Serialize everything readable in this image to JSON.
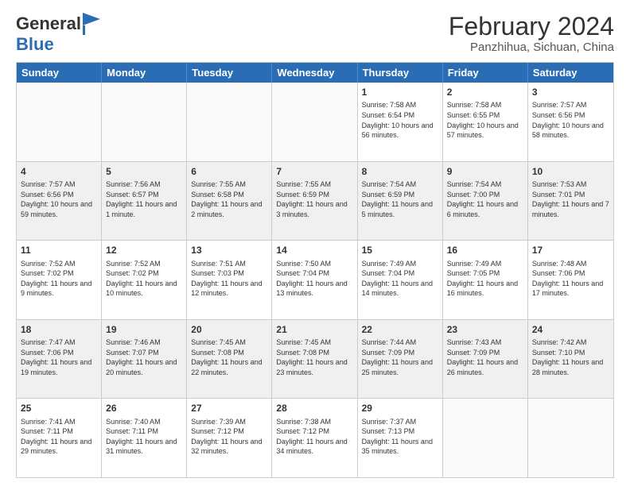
{
  "header": {
    "logo": {
      "general": "General",
      "blue": "Blue"
    },
    "title": "February 2024",
    "location": "Panzhihua, Sichuan, China"
  },
  "calendar": {
    "days_of_week": [
      "Sunday",
      "Monday",
      "Tuesday",
      "Wednesday",
      "Thursday",
      "Friday",
      "Saturday"
    ],
    "rows": [
      [
        {
          "day": "",
          "empty": true
        },
        {
          "day": "",
          "empty": true
        },
        {
          "day": "",
          "empty": true
        },
        {
          "day": "",
          "empty": true
        },
        {
          "day": "1",
          "sunrise": "7:58 AM",
          "sunset": "6:54 PM",
          "daylight": "10 hours and 56 minutes."
        },
        {
          "day": "2",
          "sunrise": "7:58 AM",
          "sunset": "6:55 PM",
          "daylight": "10 hours and 57 minutes."
        },
        {
          "day": "3",
          "sunrise": "7:57 AM",
          "sunset": "6:56 PM",
          "daylight": "10 hours and 58 minutes."
        }
      ],
      [
        {
          "day": "4",
          "sunrise": "7:57 AM",
          "sunset": "6:56 PM",
          "daylight": "10 hours and 59 minutes."
        },
        {
          "day": "5",
          "sunrise": "7:56 AM",
          "sunset": "6:57 PM",
          "daylight": "11 hours and 1 minute."
        },
        {
          "day": "6",
          "sunrise": "7:55 AM",
          "sunset": "6:58 PM",
          "daylight": "11 hours and 2 minutes."
        },
        {
          "day": "7",
          "sunrise": "7:55 AM",
          "sunset": "6:59 PM",
          "daylight": "11 hours and 3 minutes."
        },
        {
          "day": "8",
          "sunrise": "7:54 AM",
          "sunset": "6:59 PM",
          "daylight": "11 hours and 5 minutes."
        },
        {
          "day": "9",
          "sunrise": "7:54 AM",
          "sunset": "7:00 PM",
          "daylight": "11 hours and 6 minutes."
        },
        {
          "day": "10",
          "sunrise": "7:53 AM",
          "sunset": "7:01 PM",
          "daylight": "11 hours and 7 minutes."
        }
      ],
      [
        {
          "day": "11",
          "sunrise": "7:52 AM",
          "sunset": "7:02 PM",
          "daylight": "11 hours and 9 minutes."
        },
        {
          "day": "12",
          "sunrise": "7:52 AM",
          "sunset": "7:02 PM",
          "daylight": "11 hours and 10 minutes."
        },
        {
          "day": "13",
          "sunrise": "7:51 AM",
          "sunset": "7:03 PM",
          "daylight": "11 hours and 12 minutes."
        },
        {
          "day": "14",
          "sunrise": "7:50 AM",
          "sunset": "7:04 PM",
          "daylight": "11 hours and 13 minutes."
        },
        {
          "day": "15",
          "sunrise": "7:49 AM",
          "sunset": "7:04 PM",
          "daylight": "11 hours and 14 minutes."
        },
        {
          "day": "16",
          "sunrise": "7:49 AM",
          "sunset": "7:05 PM",
          "daylight": "11 hours and 16 minutes."
        },
        {
          "day": "17",
          "sunrise": "7:48 AM",
          "sunset": "7:06 PM",
          "daylight": "11 hours and 17 minutes."
        }
      ],
      [
        {
          "day": "18",
          "sunrise": "7:47 AM",
          "sunset": "7:06 PM",
          "daylight": "11 hours and 19 minutes."
        },
        {
          "day": "19",
          "sunrise": "7:46 AM",
          "sunset": "7:07 PM",
          "daylight": "11 hours and 20 minutes."
        },
        {
          "day": "20",
          "sunrise": "7:45 AM",
          "sunset": "7:08 PM",
          "daylight": "11 hours and 22 minutes."
        },
        {
          "day": "21",
          "sunrise": "7:45 AM",
          "sunset": "7:08 PM",
          "daylight": "11 hours and 23 minutes."
        },
        {
          "day": "22",
          "sunrise": "7:44 AM",
          "sunset": "7:09 PM",
          "daylight": "11 hours and 25 minutes."
        },
        {
          "day": "23",
          "sunrise": "7:43 AM",
          "sunset": "7:09 PM",
          "daylight": "11 hours and 26 minutes."
        },
        {
          "day": "24",
          "sunrise": "7:42 AM",
          "sunset": "7:10 PM",
          "daylight": "11 hours and 28 minutes."
        }
      ],
      [
        {
          "day": "25",
          "sunrise": "7:41 AM",
          "sunset": "7:11 PM",
          "daylight": "11 hours and 29 minutes."
        },
        {
          "day": "26",
          "sunrise": "7:40 AM",
          "sunset": "7:11 PM",
          "daylight": "11 hours and 31 minutes."
        },
        {
          "day": "27",
          "sunrise": "7:39 AM",
          "sunset": "7:12 PM",
          "daylight": "11 hours and 32 minutes."
        },
        {
          "day": "28",
          "sunrise": "7:38 AM",
          "sunset": "7:12 PM",
          "daylight": "11 hours and 34 minutes."
        },
        {
          "day": "29",
          "sunrise": "7:37 AM",
          "sunset": "7:13 PM",
          "daylight": "11 hours and 35 minutes."
        },
        {
          "day": "",
          "empty": true
        },
        {
          "day": "",
          "empty": true
        }
      ]
    ]
  }
}
